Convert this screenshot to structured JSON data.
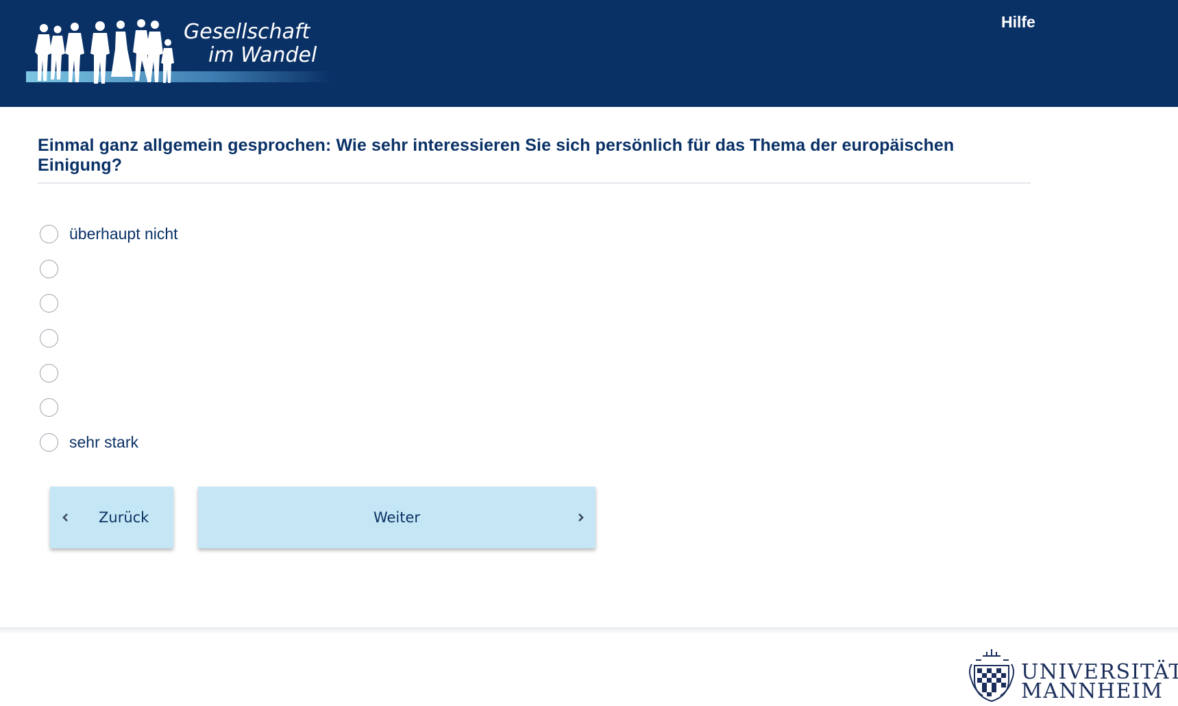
{
  "header": {
    "logo_line1": "Gesellschaft",
    "logo_line2": "im Wandel",
    "help_label": "Hilfe",
    "background_color": "#0a3166"
  },
  "question": {
    "text": "Einmal ganz allgemein gesprochen: Wie sehr interessieren Sie sich persönlich für das Thema der europäischen Einigung?"
  },
  "options": [
    {
      "label": "überhaupt nicht",
      "selected": false
    },
    {
      "label": "",
      "selected": false
    },
    {
      "label": "",
      "selected": false
    },
    {
      "label": "",
      "selected": false
    },
    {
      "label": "",
      "selected": false
    },
    {
      "label": "",
      "selected": false
    },
    {
      "label": "sehr stark",
      "selected": false
    }
  ],
  "navigation": {
    "back_label": "Zurück",
    "next_label": "Weiter",
    "button_color": "#c5e6f4"
  },
  "footer": {
    "university_line1": "UNIVERSITÄT",
    "university_line2": "MANNHEIM"
  }
}
